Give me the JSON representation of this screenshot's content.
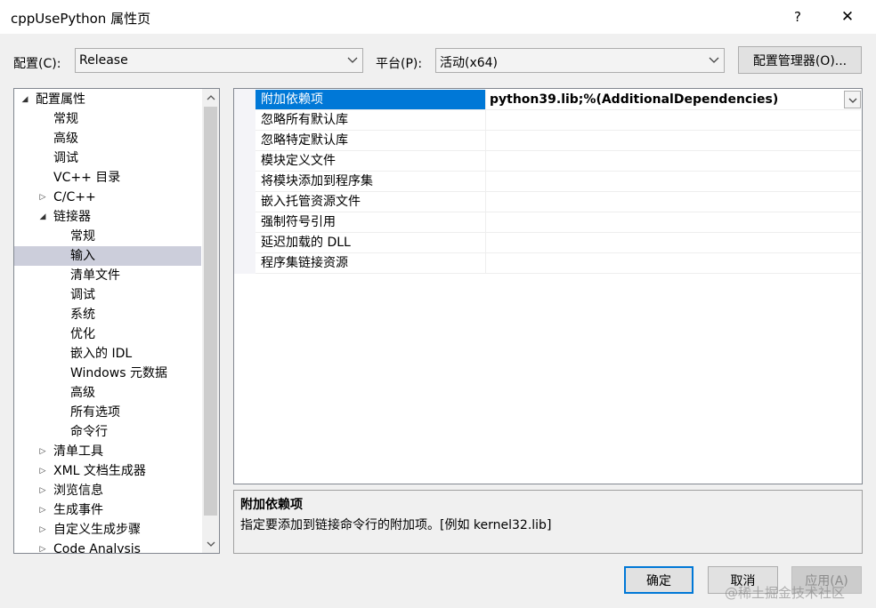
{
  "window": {
    "title": "cppUsePython 属性页",
    "help_glyph": "?",
    "close_glyph": "✕"
  },
  "toolbar": {
    "config_label": "配置(C):",
    "config_value": "Release",
    "platform_label": "平台(P):",
    "platform_value": "活动(x64)",
    "config_manager_label": "配置管理器(O)..."
  },
  "tree": {
    "items": [
      {
        "label": "配置属性",
        "level": 0,
        "toggle": "◢",
        "selected": false
      },
      {
        "label": "常规",
        "level": 1,
        "toggle": "",
        "selected": false
      },
      {
        "label": "高级",
        "level": 1,
        "toggle": "",
        "selected": false
      },
      {
        "label": "调试",
        "level": 1,
        "toggle": "",
        "selected": false
      },
      {
        "label": "VC++ 目录",
        "level": 1,
        "toggle": "",
        "selected": false
      },
      {
        "label": "C/C++",
        "level": 1,
        "toggle": "▷",
        "selected": false
      },
      {
        "label": "链接器",
        "level": 1,
        "toggle": "◢",
        "selected": false
      },
      {
        "label": "常规",
        "level": 2,
        "toggle": "",
        "selected": false
      },
      {
        "label": "输入",
        "level": 2,
        "toggle": "",
        "selected": true
      },
      {
        "label": "清单文件",
        "level": 2,
        "toggle": "",
        "selected": false
      },
      {
        "label": "调试",
        "level": 2,
        "toggle": "",
        "selected": false
      },
      {
        "label": "系统",
        "level": 2,
        "toggle": "",
        "selected": false
      },
      {
        "label": "优化",
        "level": 2,
        "toggle": "",
        "selected": false
      },
      {
        "label": "嵌入的 IDL",
        "level": 2,
        "toggle": "",
        "selected": false
      },
      {
        "label": "Windows 元数据",
        "level": 2,
        "toggle": "",
        "selected": false
      },
      {
        "label": "高级",
        "level": 2,
        "toggle": "",
        "selected": false
      },
      {
        "label": "所有选项",
        "level": 2,
        "toggle": "",
        "selected": false
      },
      {
        "label": "命令行",
        "level": 2,
        "toggle": "",
        "selected": false
      },
      {
        "label": "清单工具",
        "level": 1,
        "toggle": "▷",
        "selected": false
      },
      {
        "label": "XML 文档生成器",
        "level": 1,
        "toggle": "▷",
        "selected": false
      },
      {
        "label": "浏览信息",
        "level": 1,
        "toggle": "▷",
        "selected": false
      },
      {
        "label": "生成事件",
        "level": 1,
        "toggle": "▷",
        "selected": false
      },
      {
        "label": "自定义生成步骤",
        "level": 1,
        "toggle": "▷",
        "selected": false
      },
      {
        "label": "Code Analysis",
        "level": 1,
        "toggle": "▷",
        "selected": false
      }
    ],
    "scroll_up_glyph": "︿",
    "scroll_down_glyph": "﹀"
  },
  "properties": {
    "rows": [
      {
        "name": "附加依赖项",
        "value": "python39.lib;%(AdditionalDependencies)",
        "selected": true
      },
      {
        "name": "忽略所有默认库",
        "value": "",
        "selected": false
      },
      {
        "name": "忽略特定默认库",
        "value": "",
        "selected": false
      },
      {
        "name": "模块定义文件",
        "value": "",
        "selected": false
      },
      {
        "name": "将模块添加到程序集",
        "value": "",
        "selected": false
      },
      {
        "name": "嵌入托管资源文件",
        "value": "",
        "selected": false
      },
      {
        "name": "强制符号引用",
        "value": "",
        "selected": false
      },
      {
        "name": "延迟加载的 DLL",
        "value": "",
        "selected": false
      },
      {
        "name": "程序集链接资源",
        "value": "",
        "selected": false
      }
    ]
  },
  "description": {
    "title": "附加依赖项",
    "text": "指定要添加到链接命令行的附加项。[例如 kernel32.lib]"
  },
  "footer": {
    "ok_label": "确定",
    "cancel_label": "取消",
    "apply_label": "应用(A)"
  },
  "watermark": "@稀土掘金技术社区",
  "colors": {
    "selection_blue": "#0078d7",
    "tree_selected": "#cccedb"
  }
}
